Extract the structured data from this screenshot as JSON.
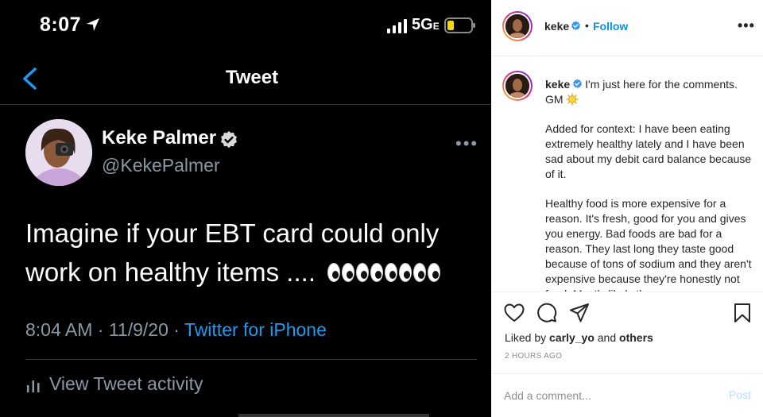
{
  "tweet_screenshot": {
    "status_bar": {
      "time": "8:07",
      "network": "5G",
      "network_suffix": "E"
    },
    "nav": {
      "title": "Tweet"
    },
    "author": {
      "display_name": "Keke Palmer",
      "handle": "@KekePalmer"
    },
    "text": "Imagine if your EBT card could only work on healthy items ....",
    "emoji": "eyes-emoji x6",
    "meta": {
      "time": "8:04 AM",
      "date": "11/9/20",
      "separator": "·",
      "source": "Twitter for iPhone"
    },
    "activity_label": "View Tweet activity",
    "accent_color": "#1d9bf0"
  },
  "instagram": {
    "header": {
      "username": "keke",
      "dot": "•",
      "follow_label": "Follow",
      "more": "•••"
    },
    "caption": {
      "username": "keke",
      "first_line": "I'm just here for the comments. GM",
      "para_2": "Added for context: I have been eating extremely healthy lately and I have been sad about my debit card balance because of it.",
      "para_3": "Healthy food is more expensive for a reason. It's fresh, good for you and gives you energy. Bad foods are bad for a reason. They last long they taste good because of tons of sodium and they aren't expensive because they're honestly not food. Mostly likely they"
    },
    "likes": {
      "prefix": "Liked by",
      "user": "carly_yo",
      "conj": "and",
      "others": "others"
    },
    "timestamp": "2 HOURS AGO",
    "comment": {
      "placeholder": "Add a comment...",
      "post_label": "Post"
    },
    "icons": [
      "heart-icon",
      "comment-icon",
      "share-icon",
      "bookmark-icon"
    ],
    "follow_color": "#0095f6"
  }
}
